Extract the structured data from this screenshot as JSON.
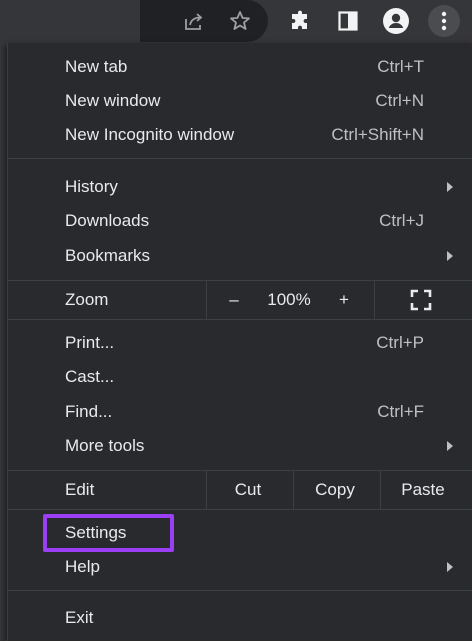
{
  "toolbar": {
    "icons": [
      "share-icon",
      "star-icon",
      "extensions-icon",
      "side-panel-icon",
      "profile-icon",
      "more-icon"
    ]
  },
  "menu": {
    "new_tab": {
      "label": "New tab",
      "shortcut": "Ctrl+T"
    },
    "new_window": {
      "label": "New window",
      "shortcut": "Ctrl+N"
    },
    "new_incognito": {
      "label": "New Incognito window",
      "shortcut": "Ctrl+Shift+N"
    },
    "history": {
      "label": "History"
    },
    "downloads": {
      "label": "Downloads",
      "shortcut": "Ctrl+J"
    },
    "bookmarks": {
      "label": "Bookmarks"
    },
    "zoom": {
      "label": "Zoom",
      "minus": "–",
      "value": "100%",
      "plus": "+"
    },
    "print": {
      "label": "Print...",
      "shortcut": "Ctrl+P"
    },
    "cast": {
      "label": "Cast..."
    },
    "find": {
      "label": "Find...",
      "shortcut": "Ctrl+F"
    },
    "more_tools": {
      "label": "More tools"
    },
    "edit": {
      "label": "Edit",
      "cut": "Cut",
      "copy": "Copy",
      "paste": "Paste"
    },
    "settings": {
      "label": "Settings"
    },
    "help": {
      "label": "Help"
    },
    "exit": {
      "label": "Exit"
    }
  },
  "colors": {
    "menu_bg": "#292a2d",
    "text": "#e8eaed",
    "highlight": "#9b3ff5"
  }
}
